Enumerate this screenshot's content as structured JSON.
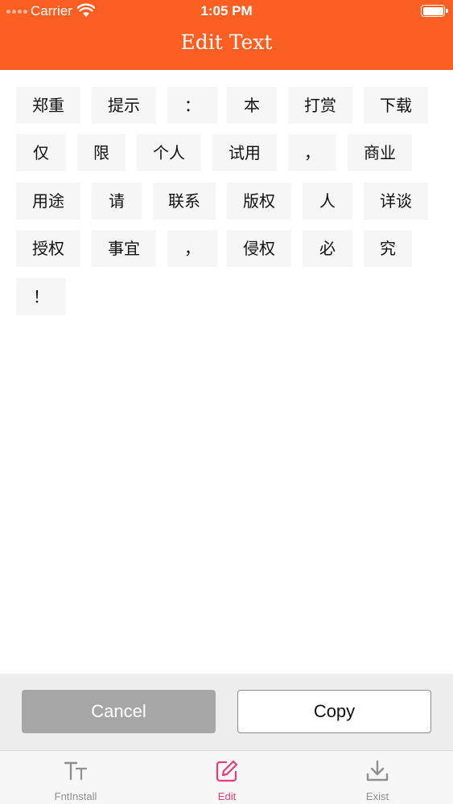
{
  "status_bar": {
    "carrier": "Carrier",
    "time": "1:05 PM"
  },
  "nav": {
    "title": "Edit Text"
  },
  "tags": [
    "郑重",
    "提示",
    "：",
    "本",
    "打赏",
    "下载",
    "仅",
    "限",
    "个人",
    "试用",
    "，",
    "商业",
    "用途",
    "请",
    "联系",
    "版权",
    "人",
    "详谈",
    "授权",
    "事宜",
    "，",
    "侵权",
    "必",
    "究",
    "！"
  ],
  "buttons": {
    "cancel": "Cancel",
    "copy": "Copy"
  },
  "tabbar": {
    "items": [
      {
        "label": "FntInstall",
        "icon": "font-size-icon",
        "active": false
      },
      {
        "label": "Edit",
        "icon": "edit-icon",
        "active": true
      },
      {
        "label": "Exist",
        "icon": "download-icon",
        "active": false
      }
    ]
  },
  "colors": {
    "accent": "#fd5f23",
    "active_tab": "#e83e77",
    "cancel_bg": "#a6a6a6"
  }
}
